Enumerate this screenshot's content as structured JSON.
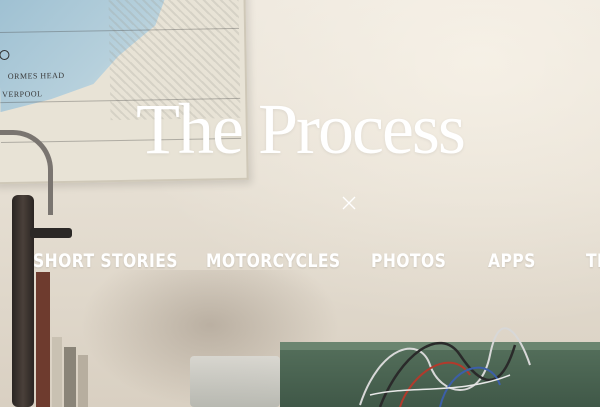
{
  "site": {
    "title": "The Process"
  },
  "overlay": {
    "close_icon": "close-icon"
  },
  "nav": {
    "items": [
      {
        "label": "SHORT STORIES"
      },
      {
        "label": "MOTORCYCLES"
      },
      {
        "label": "PHOTOS"
      },
      {
        "label": "APPS"
      },
      {
        "label": "TH"
      }
    ]
  },
  "background_photo": {
    "map_labels": [
      "ORMES HEAD",
      "VERPOOL"
    ]
  },
  "colors": {
    "nav_text": "#ffffff",
    "title_text": "#ffffff",
    "wall": "#e6dfd3",
    "box_green": "#4a6350"
  }
}
